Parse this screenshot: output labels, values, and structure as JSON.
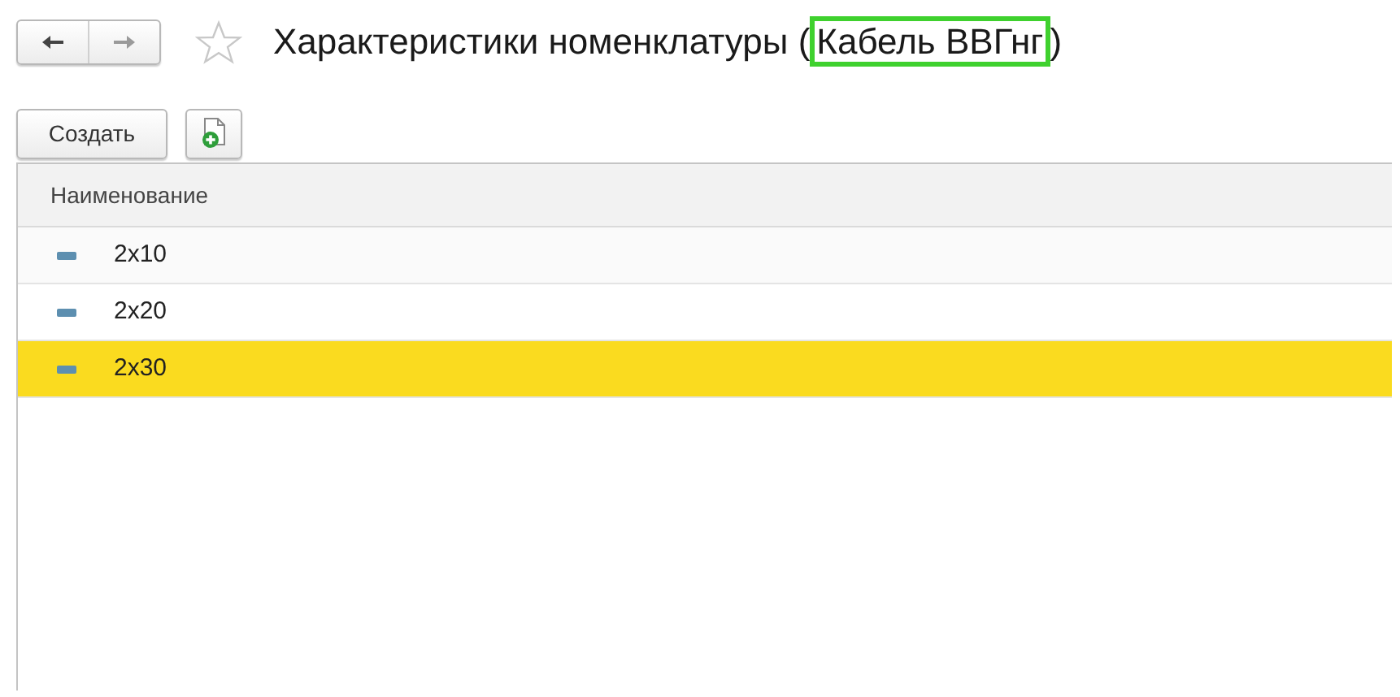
{
  "navigation": {
    "back_enabled": true,
    "forward_enabled": false
  },
  "favorite": false,
  "title": {
    "prefix": "Характеристики номенклатуры (",
    "highlighted": "Кабель ВВГнг",
    "suffix": ")"
  },
  "toolbar": {
    "create_button": "Создать"
  },
  "table": {
    "columns": [
      "Наименование"
    ],
    "rows": [
      {
        "name": "2x10",
        "selected": false
      },
      {
        "name": "2x20",
        "selected": false
      },
      {
        "name": "2x30",
        "selected": true
      }
    ]
  }
}
